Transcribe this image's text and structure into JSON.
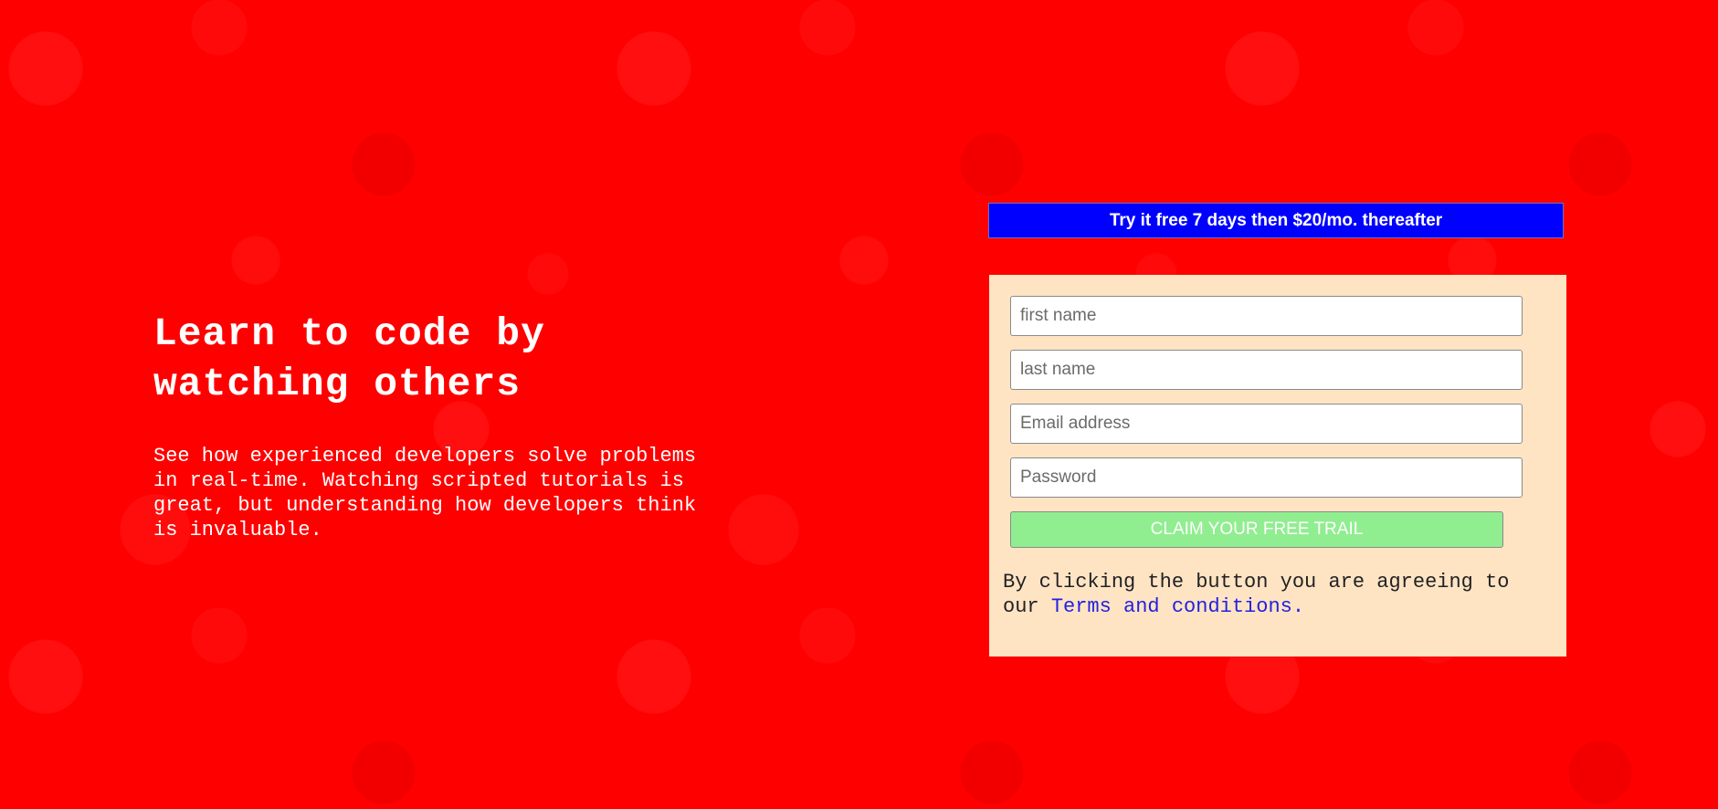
{
  "hero": {
    "title": "Learn to code by watching others",
    "description": "See how experienced developers solve problems in real-time. Watching scripted tutorials is great, but understanding how developers think is invaluable."
  },
  "offer": {
    "banner_text": "Try it free 7 days then $20/mo. thereafter"
  },
  "form": {
    "first_name_placeholder": "first name",
    "last_name_placeholder": "last name",
    "email_placeholder": "Email address",
    "password_placeholder": "Password",
    "submit_label": "CLAIM YOUR FREE TRAIL",
    "terms_prefix": "By clicking the button you are agreeing to our ",
    "terms_link_text": "Terms and conditions."
  },
  "colors": {
    "page_background": "#ff0000",
    "banner_background": "#0000ff",
    "card_background": "#ffe4c4",
    "button_background": "#90ee90",
    "link": "#2222dd"
  }
}
